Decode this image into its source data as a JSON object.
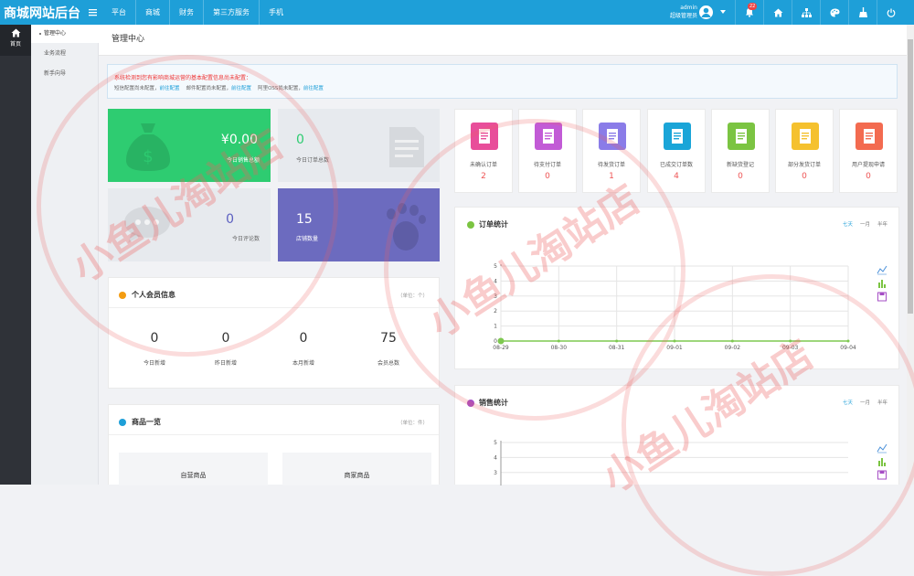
{
  "app": {
    "title": "商城网站后台"
  },
  "nav": [
    "平台",
    "商城",
    "财务",
    "第三方服务",
    "手机"
  ],
  "user": {
    "name": "admin",
    "role": "超级管理员"
  },
  "notifications": {
    "count": "22"
  },
  "sidebar": {
    "home": "首页",
    "items": [
      "管理中心",
      "业务流程",
      "新手向导"
    ]
  },
  "page": {
    "title": "管理中心"
  },
  "notice": {
    "title": "系统检测到您有影响商城运营的基本配置信息尚未配置：",
    "items": [
      {
        "text": "短信配置尚未配置，",
        "link": "前往配置"
      },
      {
        "text": "邮件配置尚未配置，",
        "link": "前往配置"
      },
      {
        "text": "阿里OSS尚未配置，",
        "link": "前往配置"
      }
    ]
  },
  "stats": [
    {
      "value": "¥0.00",
      "label": "今日销售总额"
    },
    {
      "value": "0",
      "label": "今日订单总数"
    },
    {
      "value": "0",
      "label": "今日评论数"
    },
    {
      "value": "15",
      "label": "店铺数量"
    }
  ],
  "members": {
    "title": "个人会员信息",
    "unit": "（单位：个）",
    "items": [
      {
        "value": "0",
        "label": "今日新增"
      },
      {
        "value": "0",
        "label": "昨日新增"
      },
      {
        "value": "0",
        "label": "本月新增"
      },
      {
        "value": "75",
        "label": "会员总数"
      }
    ]
  },
  "products": {
    "title": "商品一览",
    "unit": "（单位：件）",
    "items": [
      "自营商品",
      "商家商品"
    ]
  },
  "orders": [
    {
      "label": "未确认订单",
      "count": "2",
      "color": "#e84e9a"
    },
    {
      "label": "待支付订单",
      "count": "0",
      "color": "#c25bd6"
    },
    {
      "label": "待发货订单",
      "count": "1",
      "color": "#8a7ce8"
    },
    {
      "label": "已成交订单数",
      "count": "4",
      "color": "#1aa5d8"
    },
    {
      "label": "新缺货登记",
      "count": "0",
      "color": "#7bc442"
    },
    {
      "label": "部分发货订单",
      "count": "0",
      "color": "#f5c12e"
    },
    {
      "label": "用户提现申请",
      "count": "0",
      "color": "#f36b50"
    }
  ],
  "order_stats": {
    "title": "订单统计",
    "tabs": [
      "七天",
      "一月",
      "半年"
    ]
  },
  "sales_stats": {
    "title": "销售统计",
    "tabs": [
      "七天",
      "一月",
      "半年"
    ]
  },
  "watermark": {
    "text": "小鱼儿淘站店"
  },
  "colors": {
    "primary": "#1e9fd8",
    "green": "#2ecc71",
    "purple": "#6c6bbf",
    "line": "#7ec850"
  },
  "chart_data": [
    {
      "type": "line",
      "title": "订单统计",
      "x": [
        "08-29",
        "08-30",
        "08-31",
        "09-01",
        "09-02",
        "09-03",
        "09-04"
      ],
      "series": [
        {
          "values": [
            0,
            0,
            0,
            0,
            0,
            0,
            0
          ]
        }
      ],
      "ylim": [
        0,
        5
      ],
      "yticks": [
        0,
        1,
        2,
        3,
        4,
        5
      ],
      "grid": true
    },
    {
      "type": "line",
      "title": "销售统计",
      "x": [],
      "series": [],
      "ylim": [
        0,
        5
      ],
      "yticks": [
        3,
        4,
        5
      ],
      "grid": true
    }
  ]
}
